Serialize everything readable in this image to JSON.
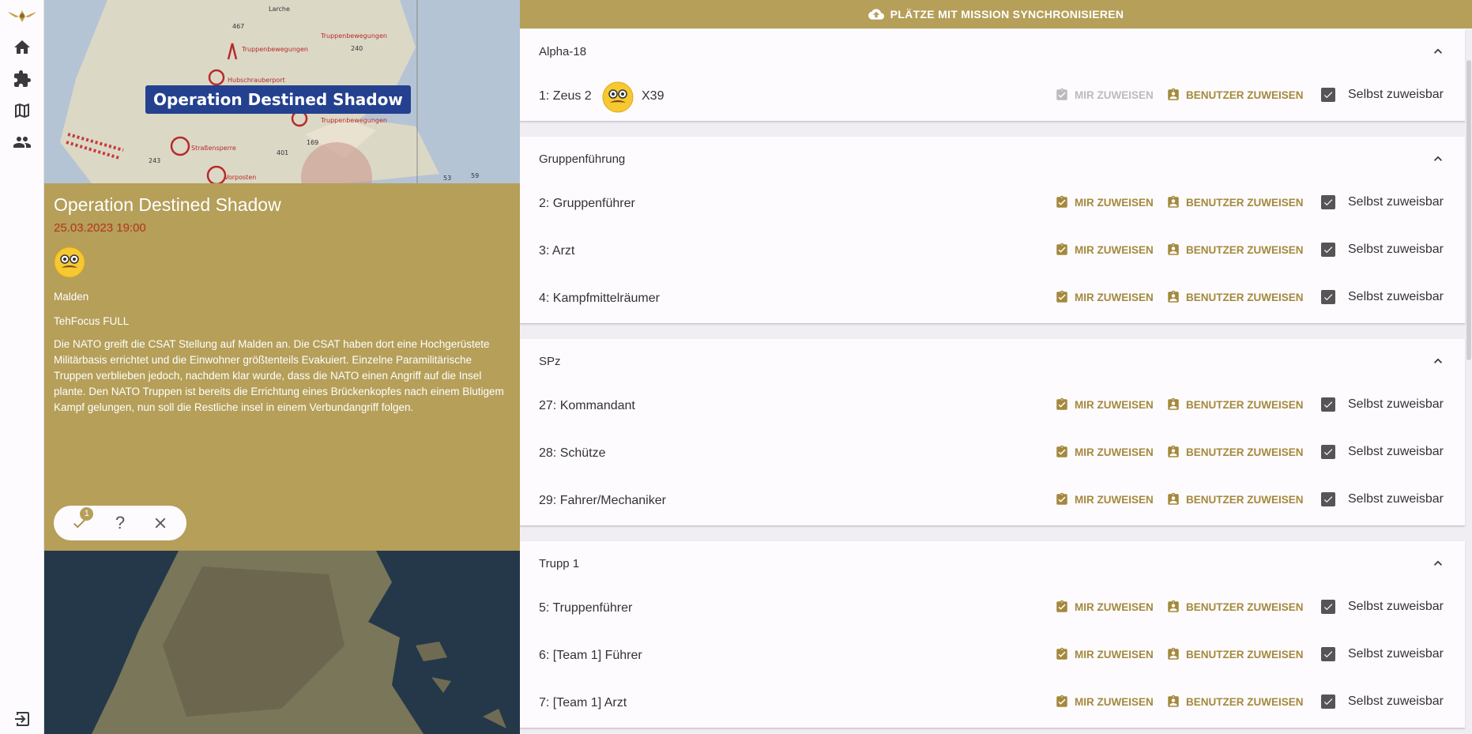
{
  "sidebar": {
    "items": [
      {
        "name": "logo-icon"
      },
      {
        "name": "home-icon"
      },
      {
        "name": "puzzle-icon"
      },
      {
        "name": "map-icon"
      },
      {
        "name": "people-icon"
      },
      {
        "name": "logout-icon"
      }
    ]
  },
  "event": {
    "map_banner": "Operation Destined Shadow",
    "title": "Operation Destined Shadow",
    "date": "25.03.2023 19:00",
    "map": "Malden",
    "modset": "TehFocus FULL",
    "description": "Die NATO greift die CSAT Stellung auf Malden an. Die CSAT haben dort eine Hochgerüstete Militärbasis errichtet und die Einwohner größtenteils Evakuiert. Einzelne Paramilitärische Truppen verblieben jedoch, nachdem klar wurde, dass die NATO einen Angriff auf die Insel plante. Den NATO Truppen ist bereits die Errichtung eines Brückenkopfes nach einem Blutigem Kampf gelungen, nun soll die Restliche insel in einem Verbundangriff folgen.",
    "rsvp": {
      "accept_count": "1",
      "maybe_symbol": "?"
    }
  },
  "main": {
    "sync_label": "PLÄTZE MIT MISSION SYNCHRONISIEREN",
    "mir_label": "MIR ZUWEISEN",
    "benutzer_label": "BENUTZER ZUWEISEN",
    "selbst_label": "Selbst zuweisbar",
    "groups": [
      {
        "title": "Alpha-18",
        "slots": [
          {
            "label": "1: Zeus 2",
            "user": "X39"
          }
        ]
      },
      {
        "title": "Gruppenführung",
        "slots": [
          {
            "label": "2: Gruppenführer"
          },
          {
            "label": "3: Arzt"
          },
          {
            "label": "4: Kampfmittelräumer"
          }
        ]
      },
      {
        "title": "SPz",
        "slots": [
          {
            "label": "27: Kommandant"
          },
          {
            "label": "28: Schütze"
          },
          {
            "label": "29: Fahrer/Mechaniker"
          }
        ]
      },
      {
        "title": "Trupp 1",
        "slots": [
          {
            "label": "5: Truppenführer"
          },
          {
            "label": "6: [Team 1] Führer"
          },
          {
            "label": "7: [Team 1] Arzt"
          }
        ]
      }
    ]
  },
  "colors": {
    "accent": "#b59f59",
    "action_text": "#a4893c",
    "date": "#b3351c",
    "banner": "#24418f"
  }
}
